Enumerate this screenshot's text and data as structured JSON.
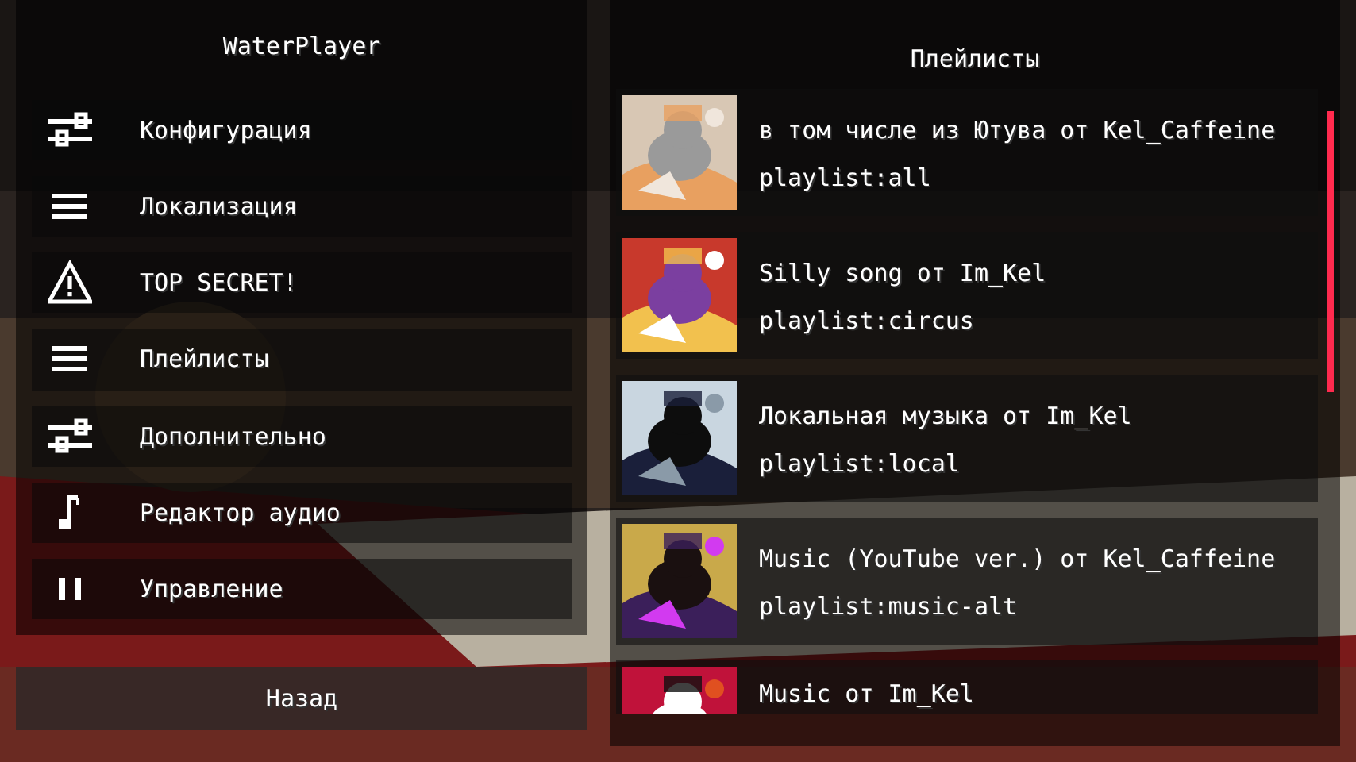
{
  "sidebar": {
    "title": "WaterPlayer",
    "items": [
      {
        "label": "Конфигурация",
        "kind": "sliders"
      },
      {
        "label": "Локализация",
        "kind": "lines"
      },
      {
        "label": "TOP SECRET!",
        "kind": "warning"
      },
      {
        "label": "Плейлисты",
        "kind": "lines"
      },
      {
        "label": "Дополнительно",
        "kind": "sliders"
      },
      {
        "label": "Редактор аудио",
        "kind": "note"
      },
      {
        "label": "Управление",
        "kind": "pause"
      }
    ],
    "back_button": "Назад"
  },
  "playlists": {
    "title": "Плейлисты",
    "items": [
      {
        "title": "в том числе из Ютува от Kel_Caffeine",
        "id_text": "playlist:all"
      },
      {
        "title": "Silly song от Im_Kel",
        "id_text": "playlist:circus"
      },
      {
        "title": "Локальная музыка от Im_Kel",
        "id_text": "playlist:local"
      },
      {
        "title": "Music (YouTube ver.) от Kel_Caffeine",
        "id_text": "playlist:music-alt"
      },
      {
        "title": "Music от Im_Kel"
      }
    ]
  }
}
